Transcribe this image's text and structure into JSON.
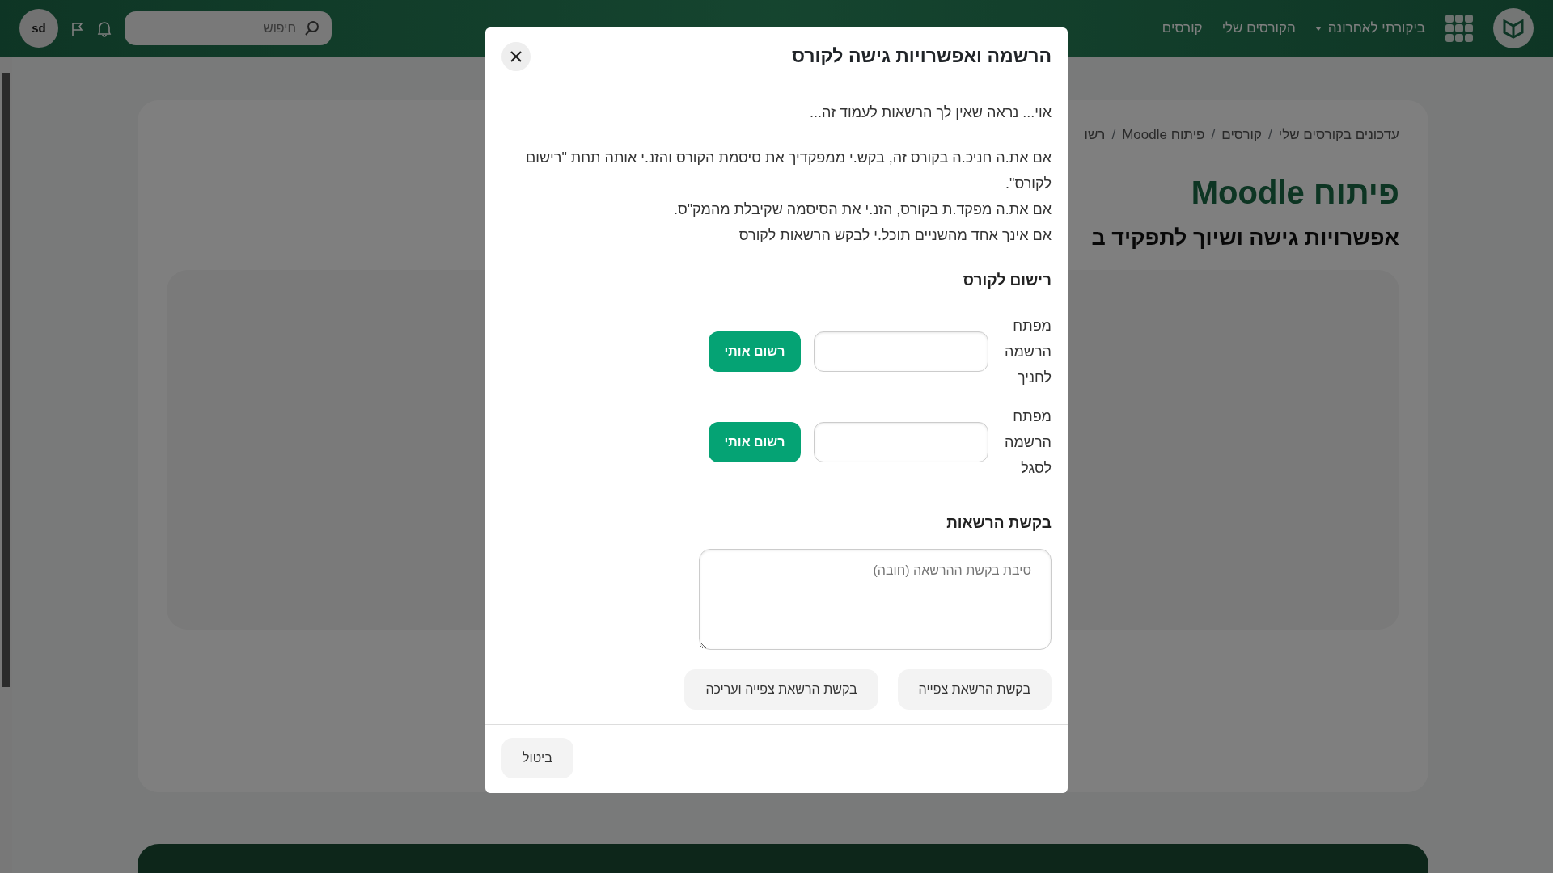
{
  "navbar": {
    "menu": [
      {
        "label": "ביקורתי לאחרונה",
        "kind": "dropdown"
      },
      {
        "label": "הקורסים שלי",
        "kind": "link"
      },
      {
        "label": "קורסים",
        "kind": "link"
      }
    ],
    "search": {
      "placeholder": "חיפוש"
    },
    "avatar": "sd"
  },
  "page": {
    "breadcrumb_separator": "/",
    "breadcrumb": [
      "עדכונים בקורסים שלי",
      "קורסים",
      "פיתוח Moodle",
      "רשו"
    ],
    "title": "פיתוח Moodle",
    "subtitle": "אפשרויות גישה ושיוך לתפקיד ב"
  },
  "modal": {
    "title": "הרשמה ואפשרויות גישה לקורס",
    "intro": "אוי... נראה שאין לך הרשאות לעמוד זה...",
    "instructions": [
      "אם את.ה חניכ.ה בקורס זה, בקש.י ממפקדיך את סיסמת הקורס והזנ.י אותה תחת \"רישום לקורס\".",
      "אם את.ה מפקד.ת בקורס, הזנ.י את הסיסמה שקיבלת מהמק\"ס.",
      "אם אינך אחד מהשניים תוכל.י לבקש הרשאות לקורס"
    ],
    "enrol": {
      "heading": "רישום לקורס",
      "methods": [
        {
          "label": "מפתח הרשמה לחניך",
          "button": "רשום אותי"
        },
        {
          "label": "מפתח הרשמה לסגל",
          "button": "רשום אותי"
        }
      ]
    },
    "request": {
      "heading": "בקשת הרשאות",
      "placeholder": "סיבת בקשת ההרשאה (חובה)",
      "buttons": [
        "בקשת הרשאת צפייה",
        "בקשת הרשאת צפייה ועריכה"
      ]
    },
    "cancel": "ביטול"
  }
}
